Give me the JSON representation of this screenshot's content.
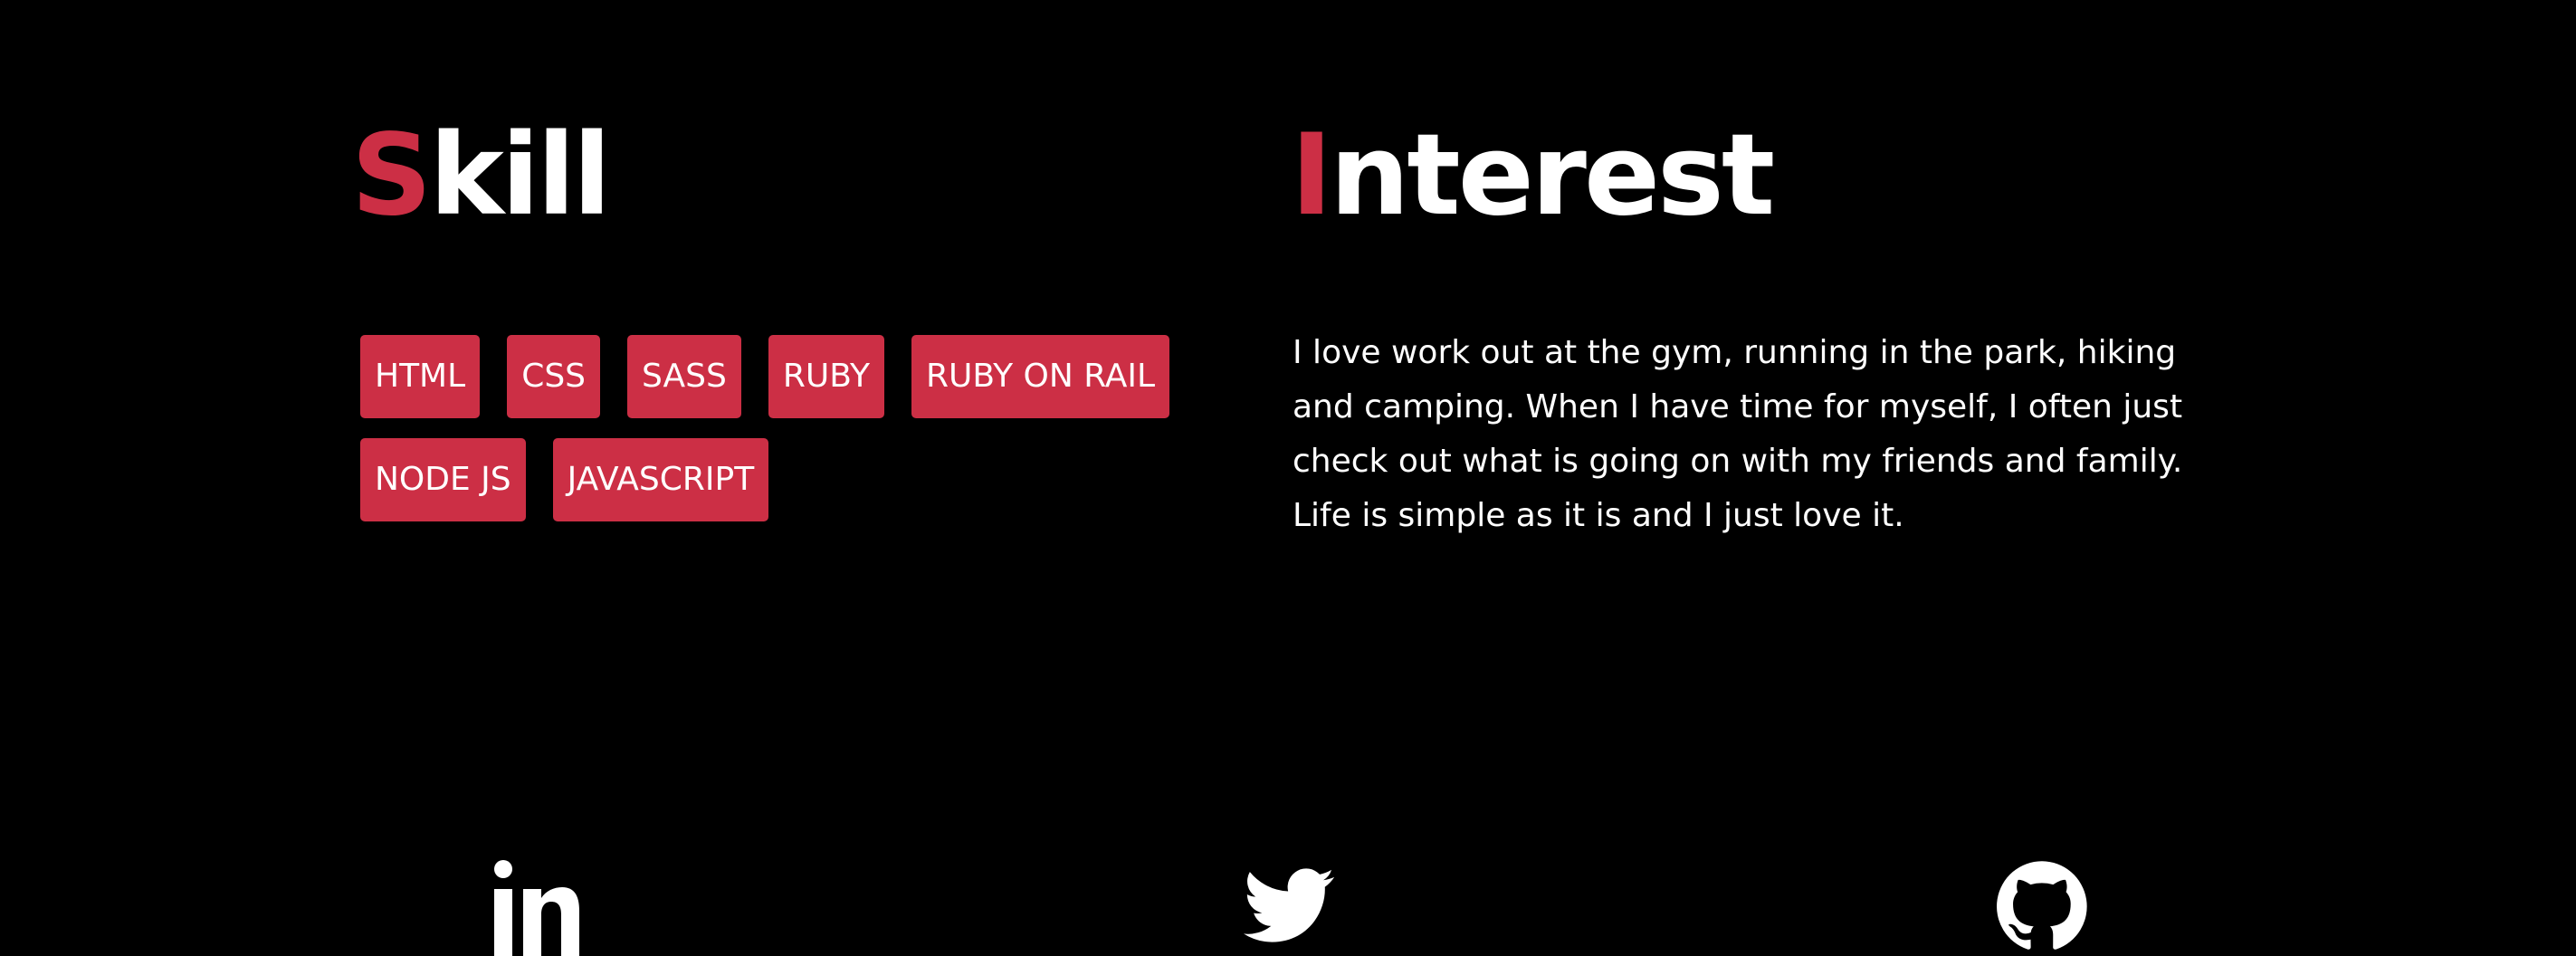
{
  "skill": {
    "title_first": "S",
    "title_rest": "kill",
    "tags_row1": [
      "HTML",
      "CSS",
      "SASS",
      "RUBY",
      "RUBY ON RAIL"
    ],
    "tags_row2": [
      "NODE JS",
      "JAVASCRIPT"
    ]
  },
  "interest": {
    "title_first": "I",
    "title_rest": "nterest",
    "text": "I love work out at the gym, running in the park, hiking and camping. When I have time for myself, I often just check out what is going on with my friends and family. Life is simple as it is and I just love it."
  },
  "social": {
    "icons": [
      "linkedin-icon",
      "twitter-icon",
      "github-icon"
    ]
  },
  "colors": {
    "accent": "#cc2f45",
    "background": "#000000",
    "text": "#ffffff"
  }
}
